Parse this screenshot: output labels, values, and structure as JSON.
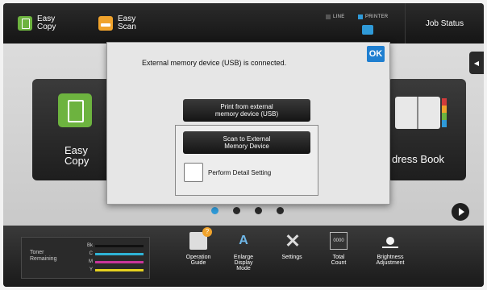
{
  "topbar": {
    "shortcuts": [
      {
        "line1": "Easy",
        "line2": "Copy",
        "icon": "copy-icon"
      },
      {
        "line1": "Easy",
        "line2": "Scan",
        "icon": "scan-icon"
      }
    ],
    "line_label": "LINE",
    "printer_label": "PRINTER",
    "job_status": "Job Status"
  },
  "main": {
    "tiles": {
      "easy_copy": {
        "line1": "Easy",
        "line2": "Copy"
      },
      "address_book": {
        "label": "dress Book"
      }
    },
    "page_indicator": {
      "count": 4,
      "active": 1
    }
  },
  "dialog": {
    "message": "External memory device (USB) is connected.",
    "ok_label": "OK",
    "print_button": {
      "line1": "Print from external",
      "line2": "memory device (USB)"
    },
    "scan_button": {
      "line1": "Scan to External",
      "line2": "Memory Device"
    },
    "detail_setting": {
      "label": "Perform Detail Setting",
      "checked": false
    }
  },
  "bottombar": {
    "toner": {
      "title_line1": "Toner",
      "title_line2": "Remaining",
      "rows": [
        {
          "key": "Bk",
          "color": "#111111"
        },
        {
          "key": "C",
          "color": "#2fb3d6"
        },
        {
          "key": "M",
          "color": "#c9359a"
        },
        {
          "key": "Y",
          "color": "#e6d21f"
        }
      ]
    },
    "buttons": [
      {
        "lines": [
          "Operation",
          "Guide"
        ],
        "icon": "operation-guide-icon"
      },
      {
        "lines": [
          "Enlarge",
          "Display",
          "Mode"
        ],
        "icon": "enlarge-display-icon"
      },
      {
        "lines": [
          "Settings"
        ],
        "icon": "settings-icon"
      },
      {
        "lines": [
          "Total",
          "Count"
        ],
        "icon": "total-count-icon"
      },
      {
        "lines": [
          "Brightness",
          "Adjustment"
        ],
        "icon": "brightness-icon"
      }
    ]
  },
  "colors": {
    "accent_blue": "#1f7fd0",
    "copy_green": "#6db33f",
    "scan_orange": "#f0a32c"
  }
}
